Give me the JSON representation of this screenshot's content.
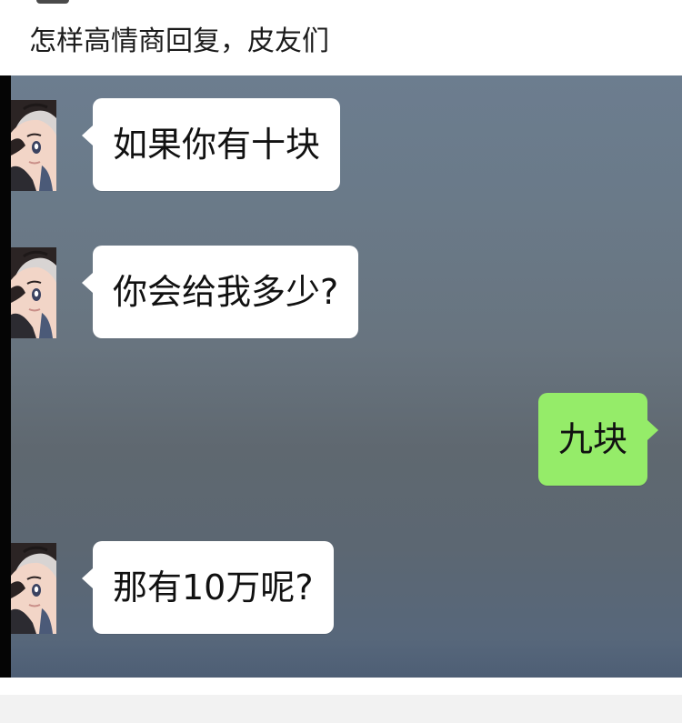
{
  "post": {
    "title": "怎样高情商回复，皮友们"
  },
  "chat": {
    "messages": [
      {
        "side": "left",
        "text": "如果你有十块"
      },
      {
        "side": "left",
        "text": "你会给我多少?"
      },
      {
        "side": "right",
        "text": "九块"
      },
      {
        "side": "left",
        "text": "那有10万呢?"
      }
    ],
    "avatar": "anime-girl-avatar-icon"
  },
  "colors": {
    "sent_bubble": "#95ec69",
    "received_bubble": "#ffffff",
    "chat_background": "#66737f"
  }
}
